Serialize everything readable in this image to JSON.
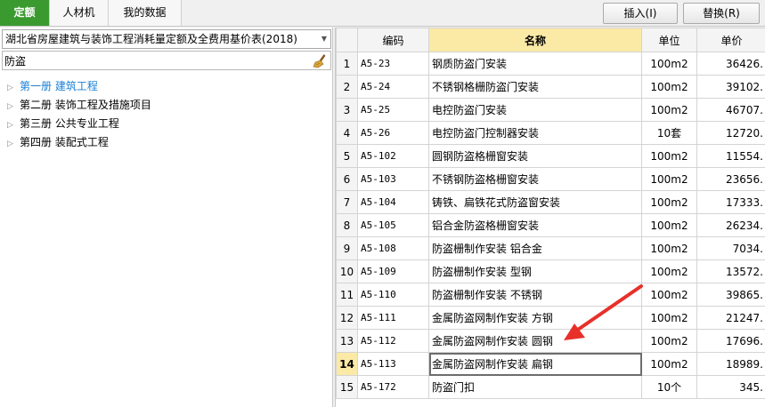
{
  "tabs": [
    {
      "label": "定额",
      "active": true
    },
    {
      "label": "人材机",
      "active": false
    },
    {
      "label": "我的数据",
      "active": false
    }
  ],
  "toolbar": {
    "insert_label": "插入(I)",
    "replace_label": "替换(R)"
  },
  "left": {
    "library": "湖北省房屋建筑与装饰工程消耗量定额及全费用基价表(2018)",
    "search_value": "防盗",
    "tree": [
      {
        "label": "第一册 建筑工程",
        "selected": true
      },
      {
        "label": "第二册 装饰工程及措施项目",
        "selected": false
      },
      {
        "label": "第三册 公共专业工程",
        "selected": false
      },
      {
        "label": "第四册 装配式工程",
        "selected": false
      }
    ]
  },
  "table": {
    "headers": [
      "",
      "编码",
      "名称",
      "单位",
      "单价"
    ],
    "current_row": 14,
    "rows": [
      {
        "idx": "1",
        "code": "A5-23",
        "name": "钢质防盗门安装",
        "unit": "100m2",
        "price": "36426."
      },
      {
        "idx": "2",
        "code": "A5-24",
        "name": "不锈钢格栅防盗门安装",
        "unit": "100m2",
        "price": "39102."
      },
      {
        "idx": "3",
        "code": "A5-25",
        "name": "电控防盗门安装",
        "unit": "100m2",
        "price": "46707."
      },
      {
        "idx": "4",
        "code": "A5-26",
        "name": "电控防盗门控制器安装",
        "unit": "10套",
        "price": "12720."
      },
      {
        "idx": "5",
        "code": "A5-102",
        "name": "圆钢防盗格栅窗安装",
        "unit": "100m2",
        "price": "11554."
      },
      {
        "idx": "6",
        "code": "A5-103",
        "name": "不锈钢防盗格栅窗安装",
        "unit": "100m2",
        "price": "23656."
      },
      {
        "idx": "7",
        "code": "A5-104",
        "name": "铸铁、扁铁花式防盗窗安装",
        "unit": "100m2",
        "price": "17333."
      },
      {
        "idx": "8",
        "code": "A5-105",
        "name": "铝合金防盗格栅窗安装",
        "unit": "100m2",
        "price": "26234."
      },
      {
        "idx": "9",
        "code": "A5-108",
        "name": "防盗栅制作安装 铝合金",
        "unit": "100m2",
        "price": "7034."
      },
      {
        "idx": "10",
        "code": "A5-109",
        "name": "防盗栅制作安装 型钢",
        "unit": "100m2",
        "price": "13572."
      },
      {
        "idx": "11",
        "code": "A5-110",
        "name": "防盗栅制作安装 不锈钢",
        "unit": "100m2",
        "price": "39865."
      },
      {
        "idx": "12",
        "code": "A5-111",
        "name": "金属防盗网制作安装 方钢",
        "unit": "100m2",
        "price": "21247."
      },
      {
        "idx": "13",
        "code": "A5-112",
        "name": "金属防盗网制作安装 圆钢",
        "unit": "100m2",
        "price": "17696."
      },
      {
        "idx": "14",
        "code": "A5-113",
        "name": "金属防盗网制作安装 扁钢",
        "unit": "100m2",
        "price": "18989."
      },
      {
        "idx": "15",
        "code": "A5-172",
        "name": "防盗门扣",
        "unit": "10个",
        "price": "345."
      }
    ]
  },
  "annotation": {
    "color": "#e8302a",
    "icon": "red-arrow"
  }
}
